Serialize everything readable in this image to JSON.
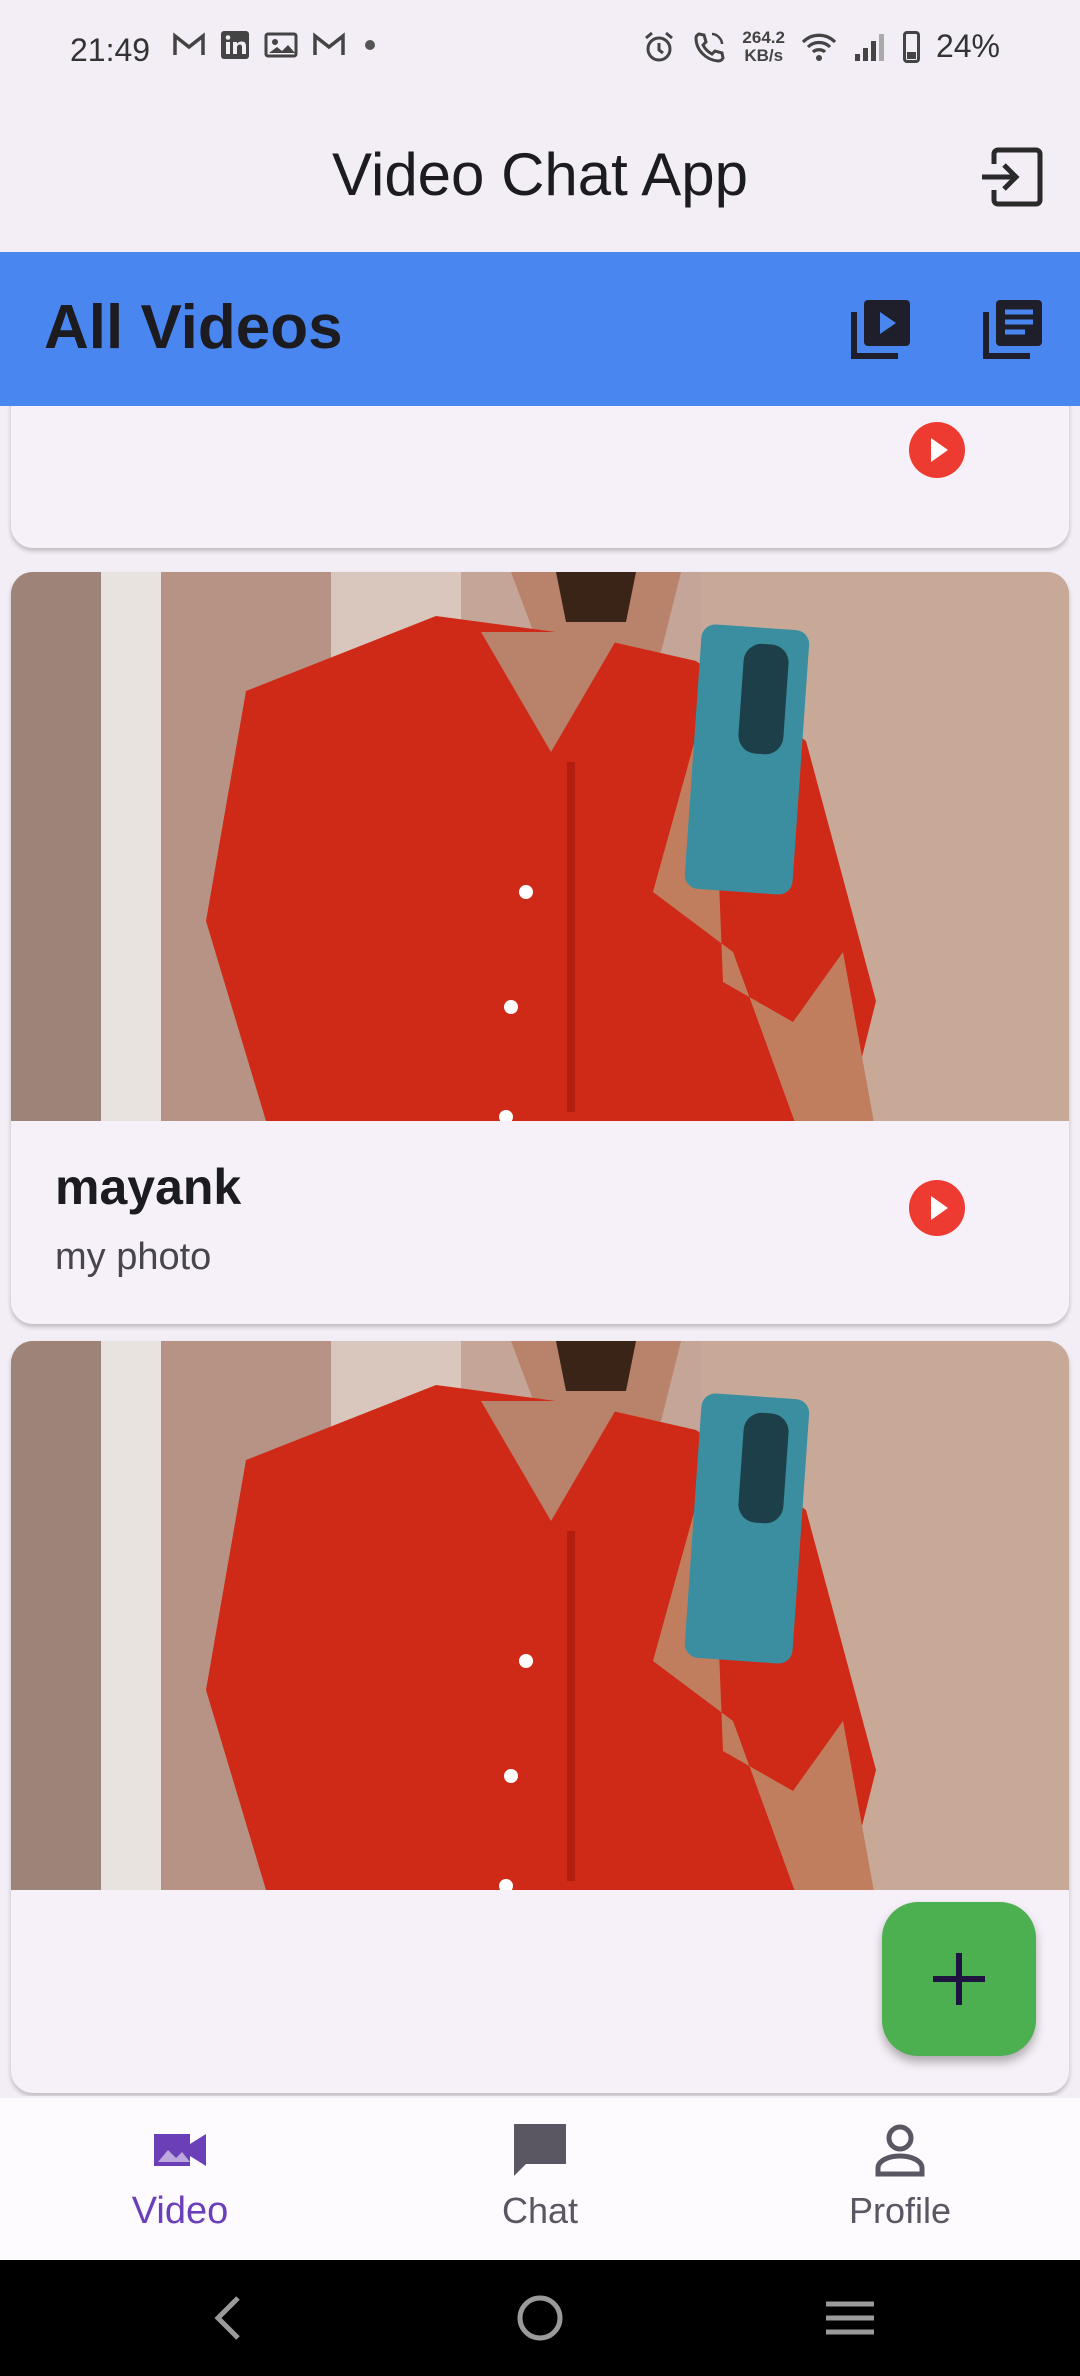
{
  "status_bar": {
    "time": "21:49",
    "left_icons": [
      "gmail-icon",
      "linkedin-icon",
      "gallery-icon",
      "gmail-icon",
      "dot-icon"
    ],
    "network_speed_value": "264.2",
    "network_speed_unit": "KB/s",
    "battery": "24%"
  },
  "app_bar": {
    "title": "Video Chat App",
    "logout_icon": "logout-icon"
  },
  "section_header": {
    "title": "All Videos",
    "icons": [
      "video-library-icon",
      "list-icon"
    ],
    "background": "#4a86f0"
  },
  "videos": [
    {
      "title": "",
      "subtitle": "",
      "play_color": "#ee3b32"
    },
    {
      "title": "mayank",
      "subtitle": "my photo",
      "play_color": "#ee3b32"
    },
    {
      "title": "",
      "subtitle": "",
      "play_color": "#ee3b32"
    }
  ],
  "fab": {
    "icon": "plus-icon",
    "color": "#4caf50"
  },
  "bottom_nav": {
    "items": [
      {
        "label": "Video",
        "icon": "video-camera-icon",
        "active": true
      },
      {
        "label": "Chat",
        "icon": "chat-icon",
        "active": false
      },
      {
        "label": "Profile",
        "icon": "person-icon",
        "active": false
      }
    ],
    "active_color": "#6b3fb8"
  },
  "system_nav": {
    "buttons": [
      "back-icon",
      "home-icon",
      "recents-icon"
    ]
  }
}
